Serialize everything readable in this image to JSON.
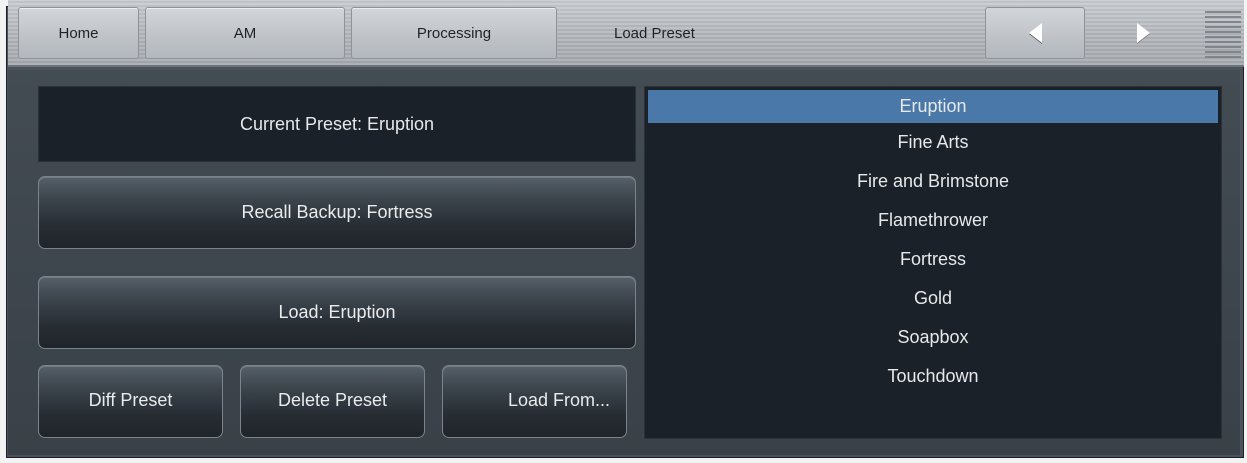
{
  "nav": {
    "home": "Home",
    "am": "AM",
    "processing": "Processing",
    "breadcrumb": "Load Preset"
  },
  "panel": {
    "current_preset": "Current Preset: Eruption",
    "recall_backup": "Recall Backup: Fortress",
    "load": "Load: Eruption",
    "diff": "Diff Preset",
    "delete": "Delete Preset",
    "load_from": "Load From..."
  },
  "presets": [
    {
      "name": "Eruption",
      "selected": true
    },
    {
      "name": "Fine Arts"
    },
    {
      "name": "Fire and Brimstone"
    },
    {
      "name": "Flamethrower"
    },
    {
      "name": "Fortress"
    },
    {
      "name": "Gold"
    },
    {
      "name": "Soapbox"
    },
    {
      "name": "Touchdown"
    }
  ],
  "colors": {
    "selected": "#4a78a8",
    "panel": "#1b2128",
    "background": "#434b53"
  },
  "icons": [
    "back-arrow-icon",
    "forward-arrow-icon",
    "menu-icon"
  ]
}
